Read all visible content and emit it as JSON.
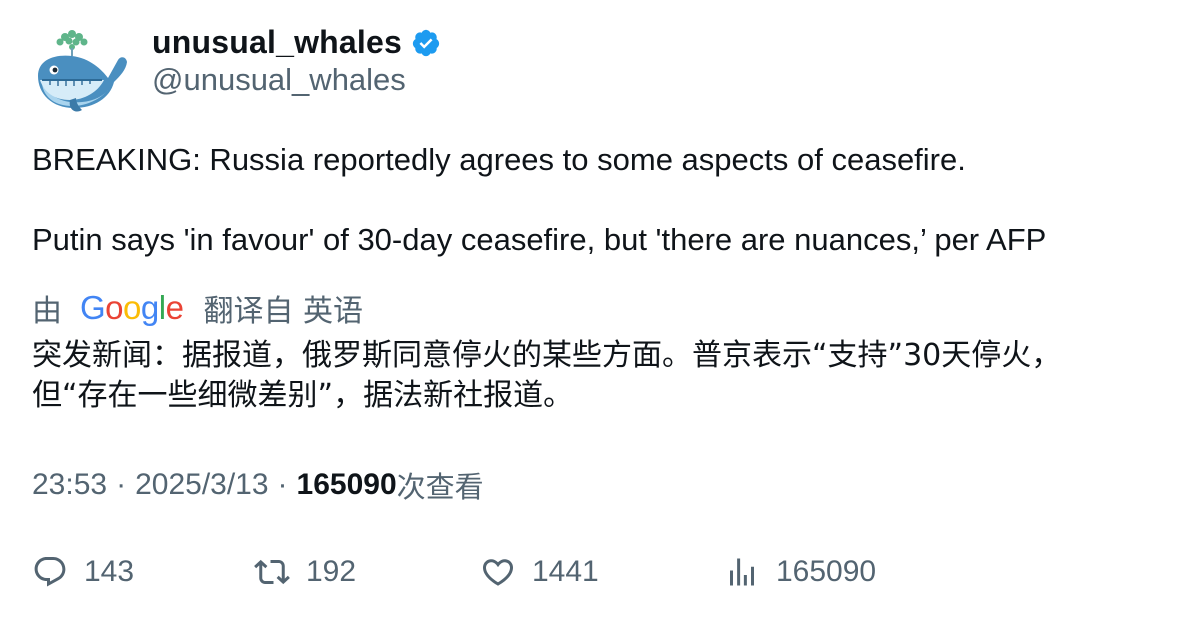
{
  "author": {
    "display_name": "unusual_whales",
    "handle": "@unusual_whales",
    "verified": true,
    "avatar_icon": "whale-avatar-icon",
    "verified_color": "#1d9bf0"
  },
  "tweet": {
    "paragraphs": [
      "BREAKING: Russia reportedly agrees to some aspects of ceasefire.",
      "Putin says 'in favour' of 30-day ceasefire, but 'there are nuances,’ per AFP"
    ]
  },
  "translation": {
    "prefix": "由",
    "provider_logo_text": [
      "G",
      "o",
      "o",
      "g",
      "l",
      "e"
    ],
    "provider_logo_colors": [
      "#4285F4",
      "#EA4335",
      "#FBBC05",
      "#4285F4",
      "#34A853",
      "#EA4335"
    ],
    "suffix": "翻译自 英语",
    "lines": [
      "突发新闻：据报道，俄罗斯同意停火的某些方面。普京表示“支持”30天停火，",
      "但“存在一些细微差别”，据法新社报道。"
    ]
  },
  "meta": {
    "time": "23:53",
    "separator": "·",
    "date": "2025/3/13",
    "views_count": "165090",
    "views_label": "次查看"
  },
  "actions": {
    "replies": "143",
    "retweets": "192",
    "likes": "1441",
    "views": "165090"
  },
  "colors": {
    "text_primary": "#0f1419",
    "text_secondary": "#536471"
  }
}
